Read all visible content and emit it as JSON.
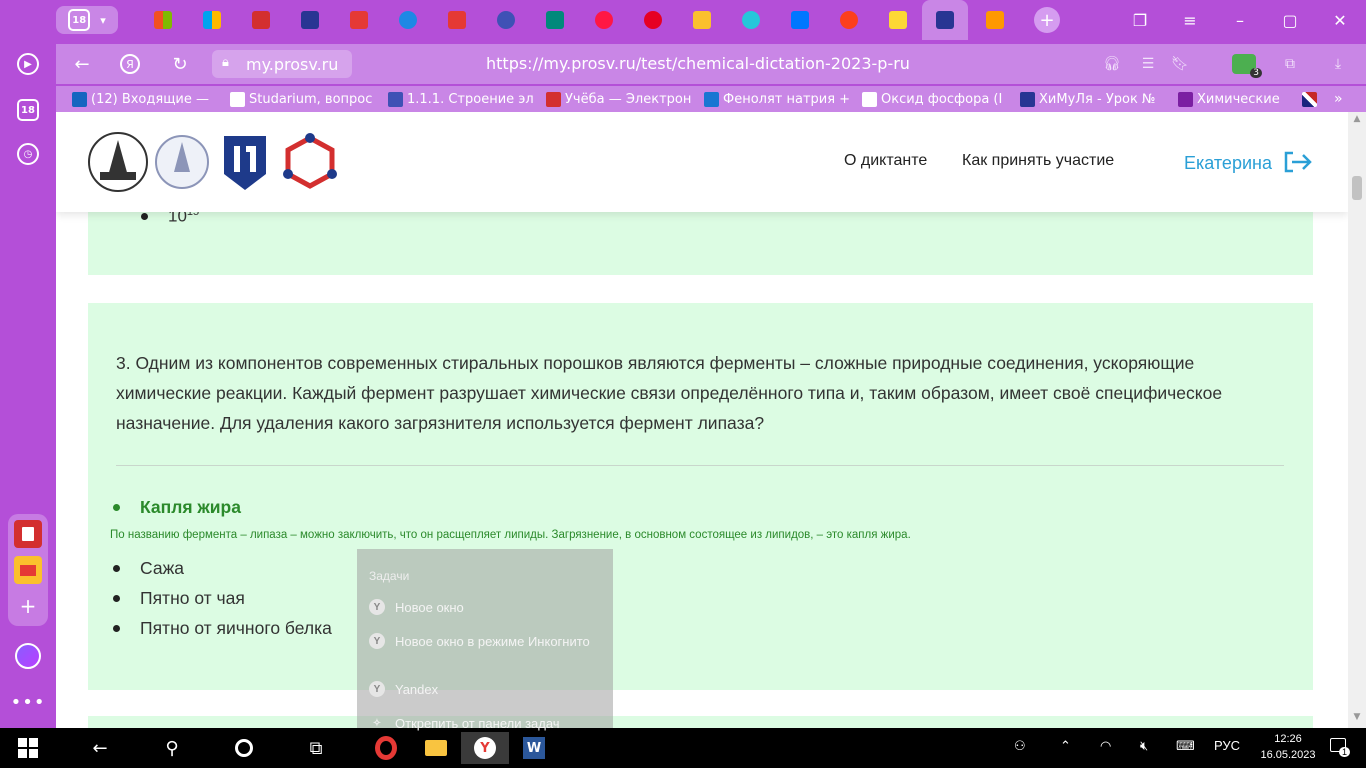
{
  "sidepanel": {
    "badge_count": "18"
  },
  "tabs": {
    "counter": "18"
  },
  "addressbar": {
    "host": "my.prosv.ru",
    "url": "https://my.prosv.ru/test/chemical-dictation-2023-p-ru",
    "extension_badge": "3"
  },
  "bookmarks": [
    {
      "label": "(12) Входящие — ",
      "color": "#1565c0"
    },
    {
      "label": "Studarium, вопрос",
      "color": "#ffffff"
    },
    {
      "label": "1.1.1. Строение эл",
      "color": "#3f51b5"
    },
    {
      "label": "Учёба — Электрон",
      "color": "#d32f2f"
    },
    {
      "label": "Фенолят натрия +",
      "color": "#1976d2"
    },
    {
      "label": "Оксид фосфора (I",
      "color": "#ffffff"
    },
    {
      "label": "ХиМуЛя - Урок №",
      "color": "#283593"
    },
    {
      "label": "Химические",
      "color": "#7b1fa2"
    }
  ],
  "header": {
    "nav_about": "О диктанте",
    "nav_howto": "Как принять участие",
    "user_name": "Екатерина"
  },
  "prev_card": {
    "answer_base": "10",
    "answer_exp": "15"
  },
  "question": {
    "text": "3. Одним из компонентов современных стиральных порошков являются ферменты – сложные природные соединения, ускоряющие химические реакции. Каждый фермент разрушает химические связи определённого типа и, таким образом, имеет своё специфическое назначение. Для удаления какого загрязнителя используется фермент липаза?",
    "correct_answer": "Капля жира",
    "explanation": "По названию фермента – липаза – можно заключить, что он расщепляет липиды. Загрязнение, в основном состоящее из липидов, – это капля жира.",
    "other_answers": [
      "Сажа",
      "Пятно от чая",
      "Пятно от яичного белка"
    ]
  },
  "jumplist": {
    "heading": "Задачи",
    "items": [
      "Новое окно",
      "Новое окно в режиме Инкогнито",
      "Yandex",
      "Открепить от панели задач"
    ]
  },
  "taskbar": {
    "language": "РУС",
    "time": "12:26",
    "date": "16.05.2023",
    "notifications": "1"
  },
  "colors": {
    "browser_accent": "#b44fd8",
    "card_bg": "#dcfce3",
    "correct_green": "#2b8a2b",
    "link_blue": "#2a9fd6"
  }
}
